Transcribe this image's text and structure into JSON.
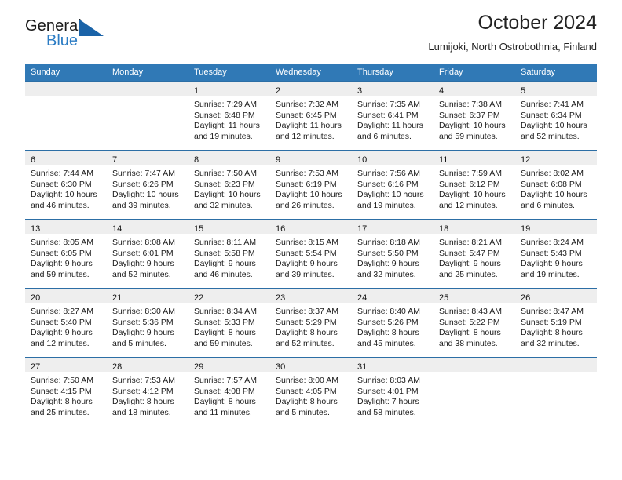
{
  "brand": {
    "word_one": "General",
    "word_two": "Blue",
    "mark": "triangle-flag-icon",
    "accent_color": "#2b7cc4"
  },
  "header": {
    "title": "October 2024",
    "subtitle": "Lumijoki, North Ostrobothnia, Finland"
  },
  "calendar": {
    "header_bg": "#3079b6",
    "row_divider_color": "#2c6ea5",
    "day_band_color": "#eeeeee",
    "weekdays": [
      "Sunday",
      "Monday",
      "Tuesday",
      "Wednesday",
      "Thursday",
      "Friday",
      "Saturday"
    ],
    "weeks": [
      [
        {
          "day": "",
          "sunrise": "",
          "sunset": "",
          "daylight": ""
        },
        {
          "day": "",
          "sunrise": "",
          "sunset": "",
          "daylight": ""
        },
        {
          "day": "1",
          "sunrise": "Sunrise: 7:29 AM",
          "sunset": "Sunset: 6:48 PM",
          "daylight": "Daylight: 11 hours and 19 minutes."
        },
        {
          "day": "2",
          "sunrise": "Sunrise: 7:32 AM",
          "sunset": "Sunset: 6:45 PM",
          "daylight": "Daylight: 11 hours and 12 minutes."
        },
        {
          "day": "3",
          "sunrise": "Sunrise: 7:35 AM",
          "sunset": "Sunset: 6:41 PM",
          "daylight": "Daylight: 11 hours and 6 minutes."
        },
        {
          "day": "4",
          "sunrise": "Sunrise: 7:38 AM",
          "sunset": "Sunset: 6:37 PM",
          "daylight": "Daylight: 10 hours and 59 minutes."
        },
        {
          "day": "5",
          "sunrise": "Sunrise: 7:41 AM",
          "sunset": "Sunset: 6:34 PM",
          "daylight": "Daylight: 10 hours and 52 minutes."
        }
      ],
      [
        {
          "day": "6",
          "sunrise": "Sunrise: 7:44 AM",
          "sunset": "Sunset: 6:30 PM",
          "daylight": "Daylight: 10 hours and 46 minutes."
        },
        {
          "day": "7",
          "sunrise": "Sunrise: 7:47 AM",
          "sunset": "Sunset: 6:26 PM",
          "daylight": "Daylight: 10 hours and 39 minutes."
        },
        {
          "day": "8",
          "sunrise": "Sunrise: 7:50 AM",
          "sunset": "Sunset: 6:23 PM",
          "daylight": "Daylight: 10 hours and 32 minutes."
        },
        {
          "day": "9",
          "sunrise": "Sunrise: 7:53 AM",
          "sunset": "Sunset: 6:19 PM",
          "daylight": "Daylight: 10 hours and 26 minutes."
        },
        {
          "day": "10",
          "sunrise": "Sunrise: 7:56 AM",
          "sunset": "Sunset: 6:16 PM",
          "daylight": "Daylight: 10 hours and 19 minutes."
        },
        {
          "day": "11",
          "sunrise": "Sunrise: 7:59 AM",
          "sunset": "Sunset: 6:12 PM",
          "daylight": "Daylight: 10 hours and 12 minutes."
        },
        {
          "day": "12",
          "sunrise": "Sunrise: 8:02 AM",
          "sunset": "Sunset: 6:08 PM",
          "daylight": "Daylight: 10 hours and 6 minutes."
        }
      ],
      [
        {
          "day": "13",
          "sunrise": "Sunrise: 8:05 AM",
          "sunset": "Sunset: 6:05 PM",
          "daylight": "Daylight: 9 hours and 59 minutes."
        },
        {
          "day": "14",
          "sunrise": "Sunrise: 8:08 AM",
          "sunset": "Sunset: 6:01 PM",
          "daylight": "Daylight: 9 hours and 52 minutes."
        },
        {
          "day": "15",
          "sunrise": "Sunrise: 8:11 AM",
          "sunset": "Sunset: 5:58 PM",
          "daylight": "Daylight: 9 hours and 46 minutes."
        },
        {
          "day": "16",
          "sunrise": "Sunrise: 8:15 AM",
          "sunset": "Sunset: 5:54 PM",
          "daylight": "Daylight: 9 hours and 39 minutes."
        },
        {
          "day": "17",
          "sunrise": "Sunrise: 8:18 AM",
          "sunset": "Sunset: 5:50 PM",
          "daylight": "Daylight: 9 hours and 32 minutes."
        },
        {
          "day": "18",
          "sunrise": "Sunrise: 8:21 AM",
          "sunset": "Sunset: 5:47 PM",
          "daylight": "Daylight: 9 hours and 25 minutes."
        },
        {
          "day": "19",
          "sunrise": "Sunrise: 8:24 AM",
          "sunset": "Sunset: 5:43 PM",
          "daylight": "Daylight: 9 hours and 19 minutes."
        }
      ],
      [
        {
          "day": "20",
          "sunrise": "Sunrise: 8:27 AM",
          "sunset": "Sunset: 5:40 PM",
          "daylight": "Daylight: 9 hours and 12 minutes."
        },
        {
          "day": "21",
          "sunrise": "Sunrise: 8:30 AM",
          "sunset": "Sunset: 5:36 PM",
          "daylight": "Daylight: 9 hours and 5 minutes."
        },
        {
          "day": "22",
          "sunrise": "Sunrise: 8:34 AM",
          "sunset": "Sunset: 5:33 PM",
          "daylight": "Daylight: 8 hours and 59 minutes."
        },
        {
          "day": "23",
          "sunrise": "Sunrise: 8:37 AM",
          "sunset": "Sunset: 5:29 PM",
          "daylight": "Daylight: 8 hours and 52 minutes."
        },
        {
          "day": "24",
          "sunrise": "Sunrise: 8:40 AM",
          "sunset": "Sunset: 5:26 PM",
          "daylight": "Daylight: 8 hours and 45 minutes."
        },
        {
          "day": "25",
          "sunrise": "Sunrise: 8:43 AM",
          "sunset": "Sunset: 5:22 PM",
          "daylight": "Daylight: 8 hours and 38 minutes."
        },
        {
          "day": "26",
          "sunrise": "Sunrise: 8:47 AM",
          "sunset": "Sunset: 5:19 PM",
          "daylight": "Daylight: 8 hours and 32 minutes."
        }
      ],
      [
        {
          "day": "27",
          "sunrise": "Sunrise: 7:50 AM",
          "sunset": "Sunset: 4:15 PM",
          "daylight": "Daylight: 8 hours and 25 minutes."
        },
        {
          "day": "28",
          "sunrise": "Sunrise: 7:53 AM",
          "sunset": "Sunset: 4:12 PM",
          "daylight": "Daylight: 8 hours and 18 minutes."
        },
        {
          "day": "29",
          "sunrise": "Sunrise: 7:57 AM",
          "sunset": "Sunset: 4:08 PM",
          "daylight": "Daylight: 8 hours and 11 minutes."
        },
        {
          "day": "30",
          "sunrise": "Sunrise: 8:00 AM",
          "sunset": "Sunset: 4:05 PM",
          "daylight": "Daylight: 8 hours and 5 minutes."
        },
        {
          "day": "31",
          "sunrise": "Sunrise: 8:03 AM",
          "sunset": "Sunset: 4:01 PM",
          "daylight": "Daylight: 7 hours and 58 minutes."
        },
        {
          "day": "",
          "sunrise": "",
          "sunset": "",
          "daylight": ""
        },
        {
          "day": "",
          "sunrise": "",
          "sunset": "",
          "daylight": ""
        }
      ]
    ]
  }
}
